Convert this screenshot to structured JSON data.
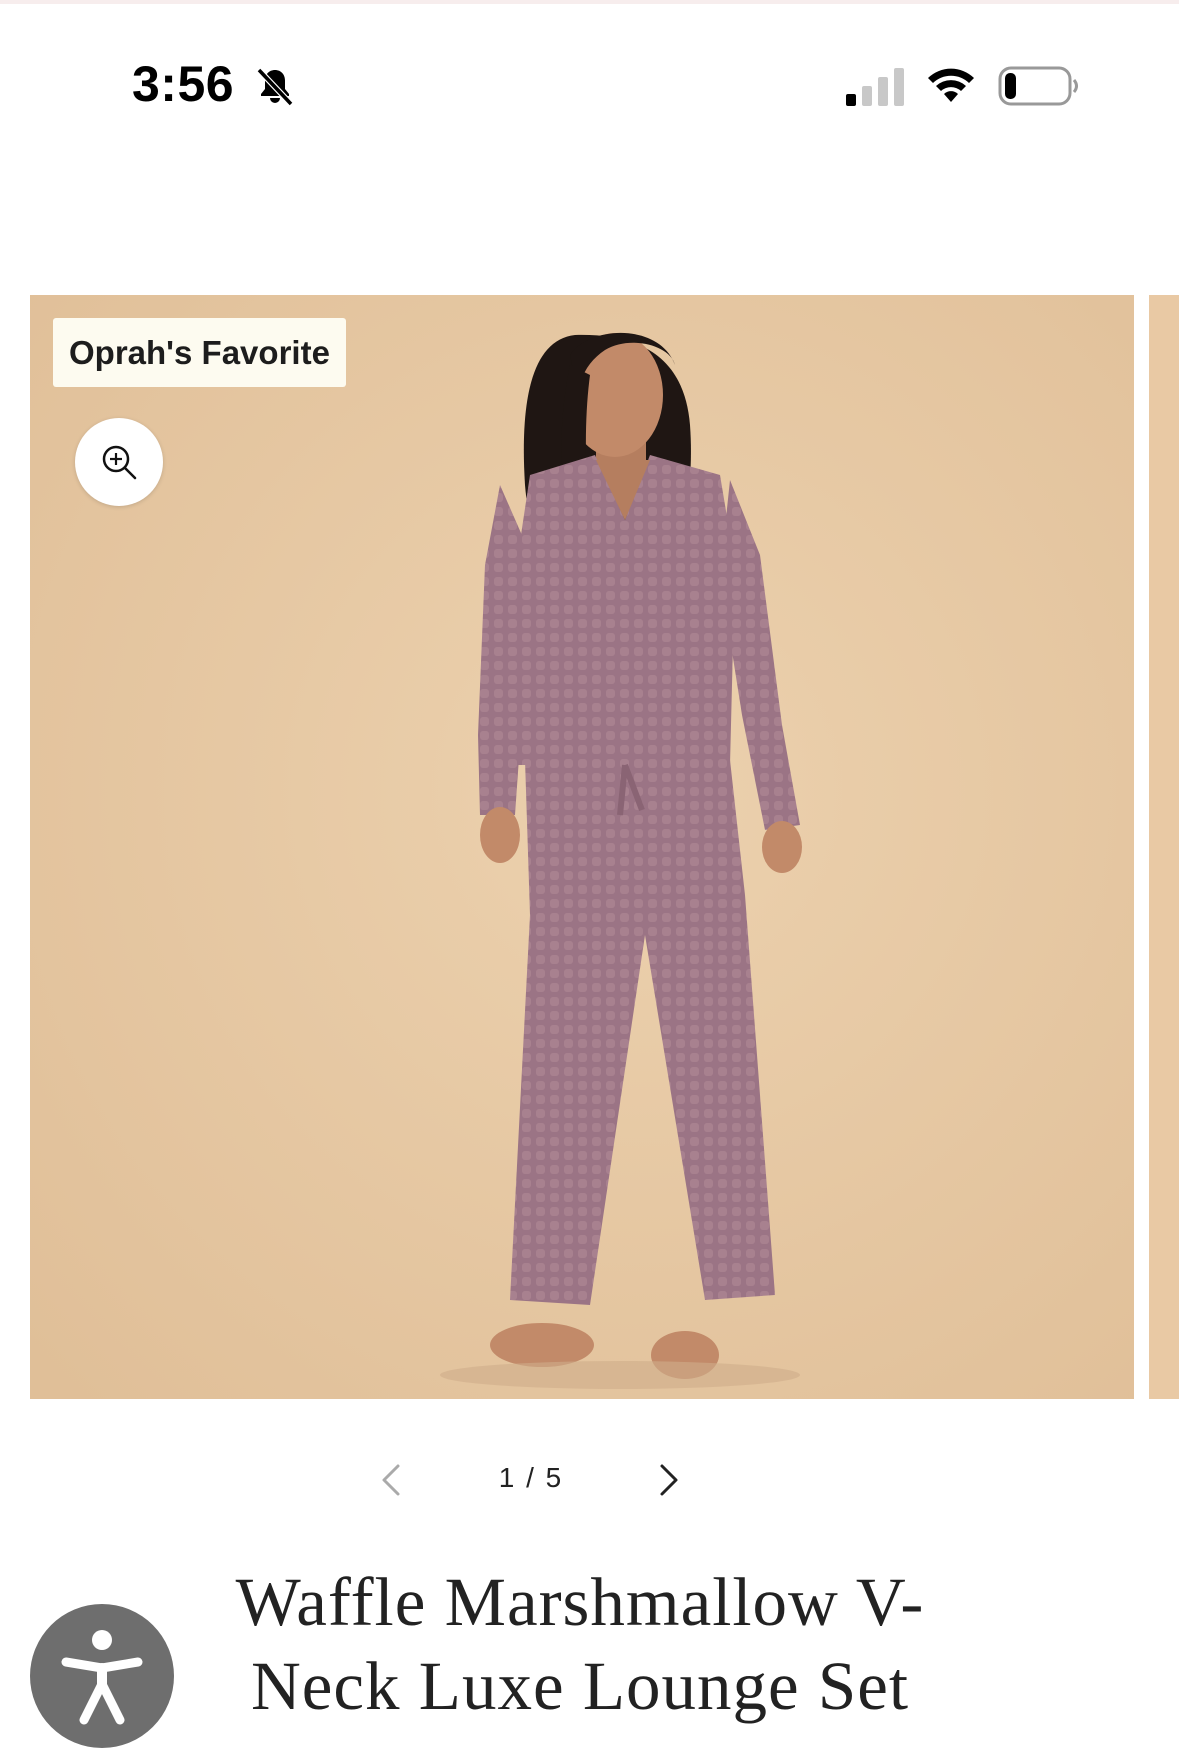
{
  "status_bar": {
    "time": "3:56",
    "silent_mode_icon": "bell-slash-icon",
    "signal_icon": "cellular-signal-icon",
    "wifi_icon": "wifi-icon",
    "battery_icon": "battery-low-icon",
    "battery_level": 0.15
  },
  "carousel": {
    "badge": "Oprah's Favorite",
    "zoom_icon": "zoom-in-icon",
    "current_slide": 1,
    "total_slides": 5,
    "counter_text": "1 / 5",
    "prev_icon": "chevron-left-icon",
    "next_icon": "chevron-right-icon"
  },
  "product": {
    "title": "Waffle Marshmallow V-Neck Luxe Lounge Set"
  },
  "accessibility": {
    "icon": "accessibility-person-icon"
  },
  "colors": {
    "photo_background": "#e7c9a4",
    "garment": "#9a7384",
    "accessibility_button": "#6e6e6e",
    "badge_background": "#fdfbf0"
  }
}
